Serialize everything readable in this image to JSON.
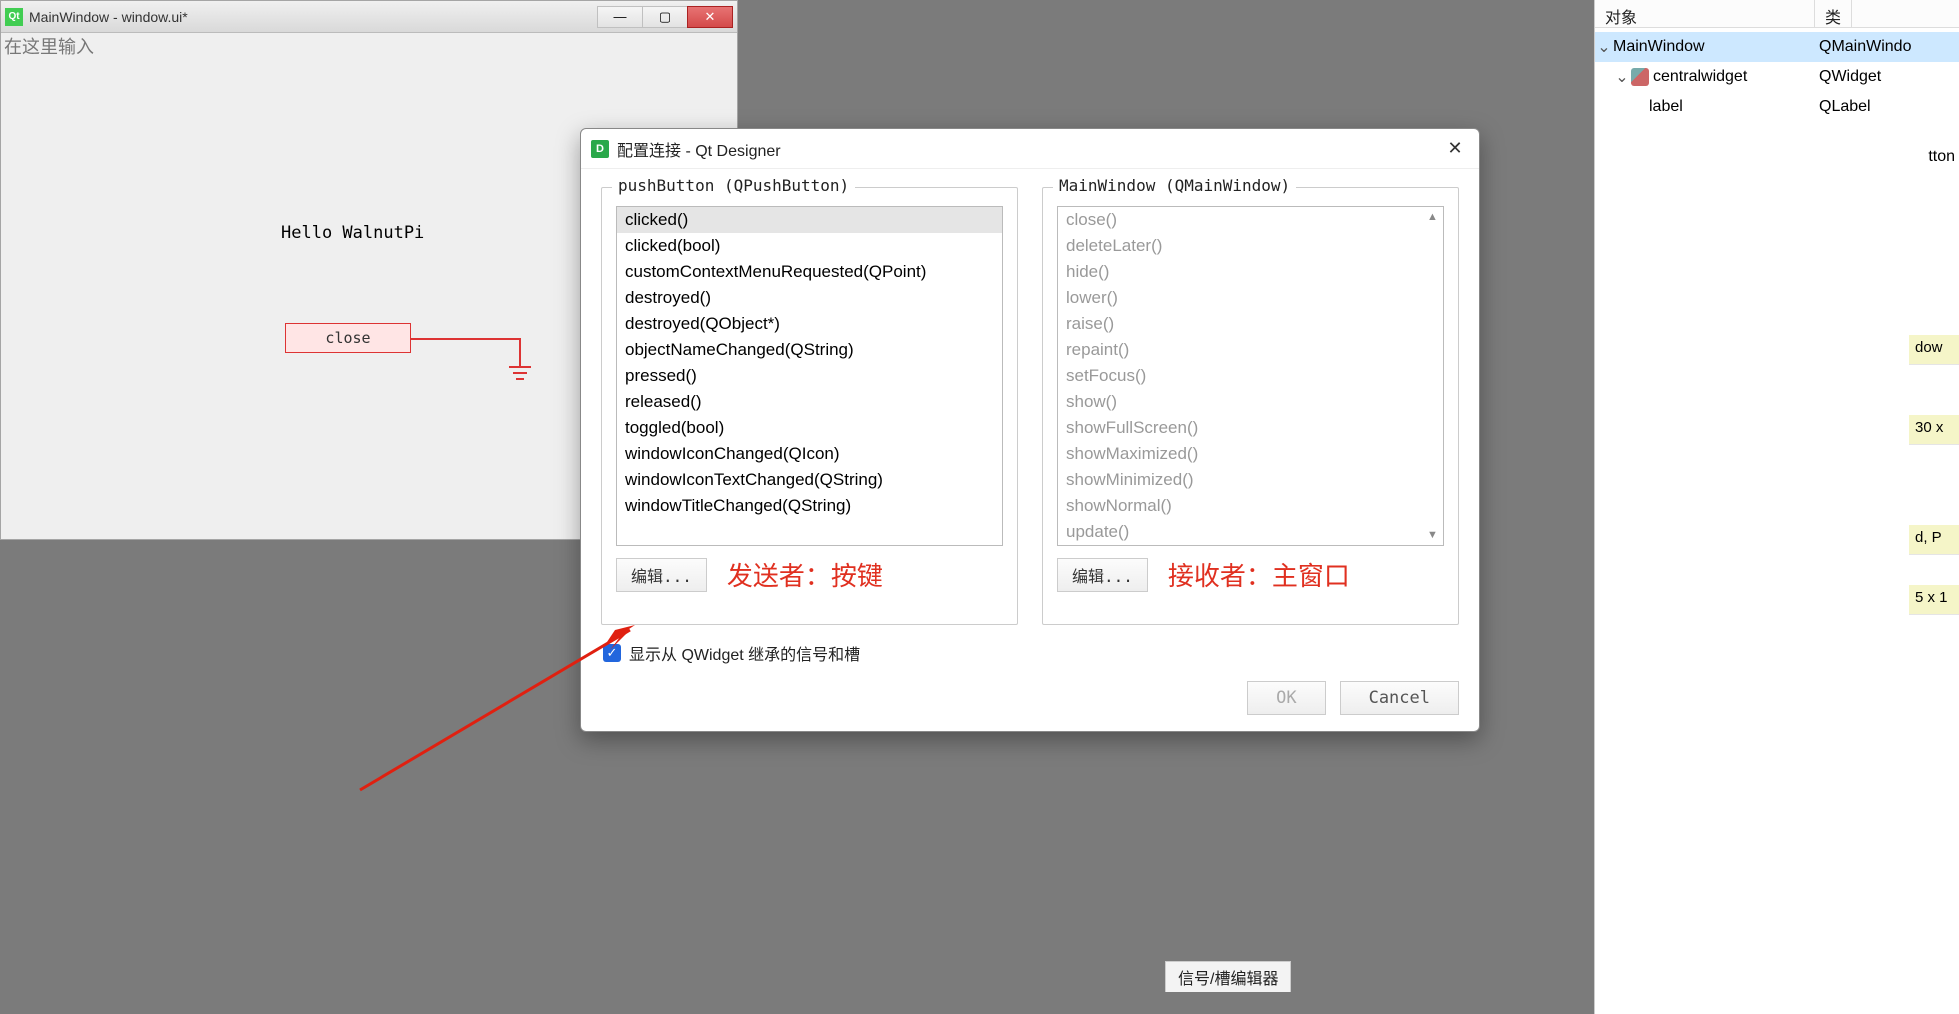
{
  "design_window": {
    "title": "MainWindow - window.ui*",
    "input_placeholder": "在这里输入",
    "hello_label": "Hello WalnutPi",
    "close_label": "close"
  },
  "object_inspector": {
    "col_object": "对象",
    "col_class": "类",
    "rows": [
      {
        "name": "MainWindow",
        "cls": "QMainWindo",
        "indent": 0,
        "caret": true
      },
      {
        "name": "centralwidget",
        "cls": "QWidget",
        "indent": 1,
        "caret": true,
        "icon": true
      },
      {
        "name": "label",
        "cls": "QLabel",
        "indent": 2
      }
    ],
    "hidden_suffix": "tton"
  },
  "prop_hints": [
    "dow",
    "30 x",
    "d, P",
    "5 x 1"
  ],
  "dialog": {
    "title": "配置连接 - Qt Designer",
    "sender_label": "pushButton (QPushButton)",
    "receiver_label": "MainWindow (QMainWindow)",
    "signals": [
      "clicked()",
      "clicked(bool)",
      "customContextMenuRequested(QPoint)",
      "destroyed()",
      "destroyed(QObject*)",
      "objectNameChanged(QString)",
      "pressed()",
      "released()",
      "toggled(bool)",
      "windowIconChanged(QIcon)",
      "windowIconTextChanged(QString)",
      "windowTitleChanged(QString)"
    ],
    "signal_selected": "clicked()",
    "slots": [
      "close()",
      "deleteLater()",
      "hide()",
      "lower()",
      "raise()",
      "repaint()",
      "setFocus()",
      "show()",
      "showFullScreen()",
      "showMaximized()",
      "showMinimized()",
      "showNormal()",
      "update()"
    ],
    "edit_label": "编辑...",
    "sender_annot": "发送者：按键",
    "receiver_annot": "接收者：主窗口",
    "checkbox_label": "显示从 QWidget 继承的信号和槽",
    "ok_label": "OK",
    "cancel_label": "Cancel"
  },
  "bottom_editor": "信号/槽编辑器"
}
